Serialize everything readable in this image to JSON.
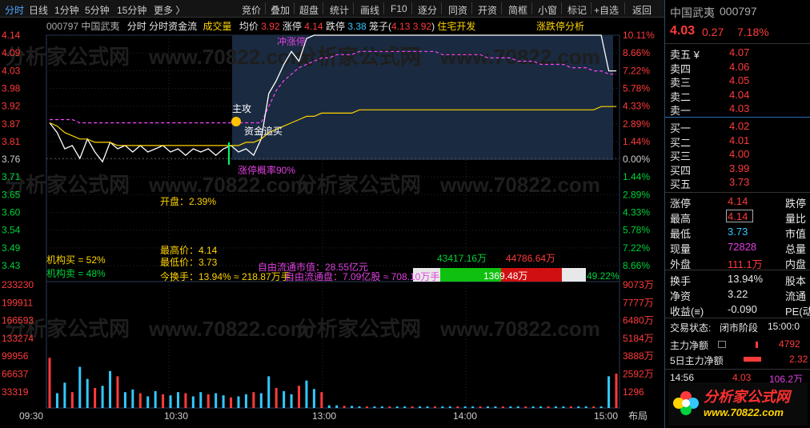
{
  "toolbar": {
    "tabs": [
      "分时",
      "日线",
      "1分钟",
      "5分钟",
      "15分钟",
      "更多 〉"
    ],
    "buttons": [
      "竞价",
      "叠加",
      "超盘",
      "统计",
      "画线",
      "F10",
      "逐分",
      "同资",
      "开资",
      "简框",
      "小窗",
      "标记",
      "+自选",
      "返回"
    ]
  },
  "header": {
    "code": "000797",
    "name": "中国武夷",
    "mode1": "分时",
    "mode2": "分时资金流",
    "volume_label": "成交量",
    "avg_label": "均价",
    "avg_value": "3.92",
    "limit_up_label": "涨停",
    "limit_up_value": "4.14",
    "limit_down_label": "跌停",
    "limit_down_value": "3.38",
    "cage_label": "笼子(",
    "cage_high": "4.13",
    "cage_low": "3.92",
    "cage_close": ")",
    "concept": "住宅开发",
    "analysis_link": "涨跌停分析"
  },
  "price_axis": {
    "left": [
      "4.14",
      "4.09",
      "4.03",
      "3.98",
      "3.92",
      "3.87",
      "3.81",
      "3.76",
      "3.71",
      "3.65",
      "3.60",
      "3.54",
      "3.49",
      "3.43"
    ],
    "right": [
      "10.11%",
      "8.66%",
      "7.22%",
      "5.78%",
      "4.33%",
      "2.89%",
      "1.44%",
      "0.00%",
      "1.44%",
      "2.89%",
      "4.33%",
      "5.78%",
      "7.22%",
      "8.66%"
    ]
  },
  "volume_axis": {
    "left": [
      "233230",
      "199911",
      "166593",
      "133274",
      "99956",
      "66637",
      "33319"
    ],
    "right": [
      "9073万",
      "7777万",
      "6480万",
      "5184万",
      "3888万",
      "2592万",
      "1296"
    ]
  },
  "time_axis": [
    "09:30",
    "10:30",
    "13:00",
    "14:00",
    "15:00"
  ],
  "time_axis_extra": "布局",
  "annotations": {
    "chong_zhangting": "冲涨停",
    "zhugong": "主攻",
    "zijin_zhuimai": "资金追买",
    "zhangting_gailv": "涨停概率90%",
    "open": "开盘：2.39%",
    "high": "最高价：4.14",
    "low": "最低价：3.73",
    "inst_buy": "机构买 = 52%",
    "inst_sell": "机构卖 = 48%",
    "turnover": "今换手：13.94% ≈ 218.87万手",
    "float_cap": "自由流通市值：28.55亿元",
    "float_shares": "自由流通盘：7.09亿股 ≈ 708.10万手",
    "flow_buy": "43417.16万",
    "flow_sell": "44786.64万",
    "flow_net": "1369.48万",
    "flow_pct": "49.22%"
  },
  "quote": {
    "name": "中国武夷",
    "code": "000797",
    "price": "4.03",
    "change": "0.27",
    "change_pct": "7.18%",
    "asks": [
      {
        "label": "卖五 ¥",
        "price": "4.07"
      },
      {
        "label": "卖四",
        "price": "4.06"
      },
      {
        "label": "卖三",
        "price": "4.05"
      },
      {
        "label": "卖二",
        "price": "4.04"
      },
      {
        "label": "卖一",
        "price": "4.03"
      }
    ],
    "bids": [
      {
        "label": "买一",
        "price": "4.02"
      },
      {
        "label": "买二",
        "price": "4.01"
      },
      {
        "label": "买三",
        "price": "4.00"
      },
      {
        "label": "买四",
        "price": "3.99"
      },
      {
        "label": "买五",
        "price": "3.73"
      }
    ],
    "stats": [
      {
        "l1": "涨停",
        "v1": "4.14",
        "l2": "跌停"
      },
      {
        "l1": "最高",
        "v1": "4.14",
        "l2": "量比"
      },
      {
        "l1": "最低",
        "v1": "3.73",
        "l2": "市值"
      },
      {
        "l1": "现量",
        "v1": "72828",
        "l2": "总量"
      },
      {
        "l1": "外盘",
        "v1": "111.1万",
        "l2": "内盘"
      }
    ],
    "stats2": [
      {
        "l1": "换手",
        "v1": "13.94%",
        "l2": "股本"
      },
      {
        "l1": "净资",
        "v1": "3.22",
        "l2": "流通"
      },
      {
        "l1": "收益(≡)",
        "v1": "-0.090",
        "l2": "PE(动)"
      }
    ],
    "trade_status_label": "交易状态:",
    "trade_status": "闭市阶段",
    "trade_time": "15:00:0",
    "main_net_label": "主力净额",
    "main_net_value": "4792",
    "main5_label": "5日主力净额",
    "main5_value": "2.32",
    "tick_time": "14:56",
    "tick_price": "4.03",
    "tick_vol": "106.2万"
  },
  "watermark": "分析家公式网",
  "watermark_url": "www.70822.com",
  "chart_data": {
    "type": "line",
    "prev_close": 3.76,
    "ylim": [
      3.43,
      4.14
    ],
    "series": [
      {
        "values": [
          3.87,
          3.84,
          3.79,
          3.8,
          3.76,
          3.82,
          3.78,
          3.75,
          3.81,
          3.79,
          3.8,
          3.78,
          3.8,
          3.78,
          3.79,
          3.8,
          3.78,
          3.79,
          3.77,
          3.79,
          3.78,
          3.79,
          3.77,
          3.79,
          3.8,
          3.78,
          3.79,
          3.77,
          3.82,
          3.96,
          4.0,
          4.05,
          4.09,
          4.06,
          4.13,
          4.14,
          4.14,
          4.14,
          4.14,
          4.14,
          4.14,
          4.14,
          4.14,
          4.14,
          4.14,
          4.14,
          4.14,
          4.14,
          4.14,
          4.14,
          4.14,
          4.14,
          4.14,
          4.14,
          4.14,
          4.14,
          4.14,
          4.14,
          4.14,
          4.14,
          4.14,
          4.14,
          4.14,
          4.14,
          4.14,
          4.14,
          4.14,
          4.14,
          4.14,
          4.14,
          4.14,
          4.14,
          4.14,
          4.14,
          4.03,
          4.03
        ]
      },
      {
        "values": [
          3.87,
          3.86,
          3.84,
          3.83,
          3.82,
          3.82,
          3.81,
          3.81,
          3.81,
          3.8,
          3.8,
          3.8,
          3.8,
          3.8,
          3.8,
          3.8,
          3.8,
          3.8,
          3.8,
          3.8,
          3.8,
          3.8,
          3.8,
          3.8,
          3.8,
          3.8,
          3.81,
          3.81,
          3.82,
          3.84,
          3.85,
          3.86,
          3.87,
          3.88,
          3.89,
          3.89,
          3.9,
          3.9,
          3.9,
          3.9,
          3.9,
          3.91,
          3.91,
          3.91,
          3.91,
          3.91,
          3.91,
          3.91,
          3.91,
          3.91,
          3.91,
          3.91,
          3.91,
          3.91,
          3.91,
          3.91,
          3.91,
          3.91,
          3.91,
          3.91,
          3.91,
          3.91,
          3.91,
          3.91,
          3.91,
          3.91,
          3.91,
          3.91,
          3.91,
          3.91,
          3.91,
          3.91,
          3.91,
          3.92,
          3.92,
          3.92
        ]
      },
      {
        "values": [
          3.88,
          3.88,
          3.88,
          3.88,
          3.87,
          3.87,
          3.87,
          3.87,
          3.87,
          3.87,
          3.87,
          3.87,
          3.87,
          3.87,
          3.87,
          3.87,
          3.87,
          3.87,
          3.87,
          3.87,
          3.87,
          3.87,
          3.87,
          3.87,
          3.87,
          3.87,
          3.87,
          3.87,
          3.87,
          3.92,
          3.97,
          4.0,
          4.02,
          4.04,
          4.05,
          4.06,
          4.07,
          4.07,
          4.08,
          4.08,
          4.08,
          4.09,
          4.09,
          4.09,
          4.09,
          4.09,
          4.09,
          4.09,
          4.09,
          4.09,
          4.09,
          4.09,
          4.08,
          4.08,
          4.08,
          4.08,
          4.08,
          4.08,
          4.07,
          4.07,
          4.07,
          4.07,
          4.06,
          4.06,
          4.06,
          4.05,
          4.05,
          4.05,
          4.05,
          4.04,
          4.04,
          4.04,
          4.03,
          4.03,
          4.02,
          4.02
        ]
      }
    ],
    "volume": [
      95000,
      28000,
      48000,
      30000,
      78000,
      55000,
      38000,
      42000,
      70000,
      60000,
      30000,
      35000,
      28000,
      22000,
      32000,
      26000,
      24000,
      30000,
      28000,
      22000,
      30000,
      26000,
      28000,
      24000,
      20000,
      22000,
      26000,
      30000,
      28000,
      60000,
      38000,
      32000,
      26000,
      42000,
      52000,
      36000,
      30000,
      5000,
      5000,
      4000,
      4000,
      3000,
      3000,
      3000,
      3000,
      3000,
      3000,
      3000,
      3000,
      3000,
      3000,
      3000,
      3000,
      3000,
      3000,
      3000,
      3000,
      3000,
      3000,
      3000,
      3000,
      3000,
      3000,
      3000,
      3000,
      3000,
      3000,
      3000,
      3000,
      3000,
      3000,
      3000,
      3000,
      3000,
      60000,
      65000
    ],
    "volume_ylim": [
      0,
      233230
    ],
    "fund_flow_bars": [
      1,
      0,
      1,
      0,
      0,
      1,
      0,
      1,
      0,
      0,
      1,
      0,
      1,
      0,
      0,
      1,
      0,
      1,
      0,
      1,
      0,
      0,
      1,
      0,
      1,
      0,
      0,
      1,
      0,
      1,
      1,
      1,
      0,
      1,
      1,
      0,
      1
    ]
  }
}
